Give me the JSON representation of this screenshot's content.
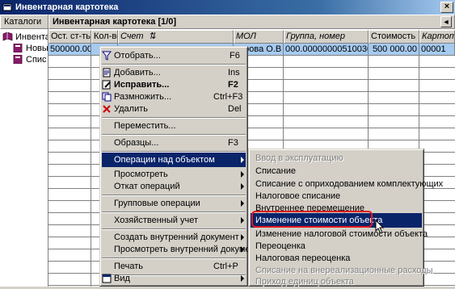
{
  "window": {
    "title": "Инвентарная картотека",
    "close_glyph": "×"
  },
  "left": {
    "header": "Каталоги",
    "tree": [
      {
        "label": "Инвентар",
        "icon": "books-icon"
      },
      {
        "label": "Новы",
        "icon": "book-icon"
      },
      {
        "label": "Спис",
        "icon": "book-icon"
      }
    ]
  },
  "main": {
    "header": "Инвентарная картотека [1/0]",
    "pin_glyph": "◄",
    "columns": [
      "Ост. ст-ть",
      "Кол-во",
      "Счет",
      "МОЛ",
      "Группа, номер",
      "Стоимость",
      "Картотека"
    ],
    "sort_indicator": "⇅",
    "rows": [
      {
        "ost": "500000.00",
        "qty": "",
        "acct": "",
        "mol": "карова О.В",
        "group": "000.000000005100301",
        "cost": "500 000.00",
        "card": "00001"
      }
    ]
  },
  "context_menu": {
    "items": [
      {
        "label": "Отобрать...",
        "shortcut": "F6",
        "icon": "filter-icon"
      },
      {
        "label": "Добавить...",
        "shortcut": "Ins",
        "icon": "add-doc-icon"
      },
      {
        "label": "Исправить...",
        "shortcut": "F2",
        "icon": "edit-icon",
        "bold": true
      },
      {
        "label": "Размножить...",
        "shortcut": "Ctrl+F3",
        "icon": "copy-icon"
      },
      {
        "label": "Удалить",
        "shortcut": "Del",
        "icon": "delete-icon"
      },
      {
        "label": "Переместить...",
        "shortcut": ""
      },
      {
        "label": "Образцы...",
        "shortcut": "F3"
      },
      {
        "label": "Операции над объектом",
        "submenu": true,
        "active": true
      },
      {
        "label": "Просмотреть",
        "submenu": true
      },
      {
        "label": "Откат операций",
        "submenu": true
      },
      {
        "label": "Групповые операции",
        "submenu": true
      },
      {
        "label": "Хозяйственный учет",
        "submenu": true
      },
      {
        "label": "Создать внутренний документ",
        "submenu": true
      },
      {
        "label": "Просмотреть внутренний документ",
        "submenu": true
      },
      {
        "label": "Печать",
        "shortcut": "Ctrl+P"
      },
      {
        "label": "Вид",
        "submenu": true,
        "icon": "view-icon"
      }
    ]
  },
  "submenu": {
    "items": [
      {
        "label": "Ввод в эксплуатацию",
        "disabled": true
      },
      {
        "label": "Списание"
      },
      {
        "label": "Списание с оприходованием комплектующих"
      },
      {
        "label": "Налоговое списание"
      },
      {
        "label": "Внутреннее перемещение"
      },
      {
        "label": "Изменение стоимости объекта",
        "active": true
      },
      {
        "label": "Изменение налоговой стоимости объекта"
      },
      {
        "label": "Переоценка"
      },
      {
        "label": "Налоговая переоценка"
      },
      {
        "label": "Списание на внереализационные расходы",
        "disabled": true
      },
      {
        "label": "Приход единиц объекта",
        "disabled": true
      }
    ]
  },
  "colors": {
    "menu_highlight": "#0a246a",
    "row_selected": "#a6caf0",
    "annotation_ring": "#e0191e"
  }
}
